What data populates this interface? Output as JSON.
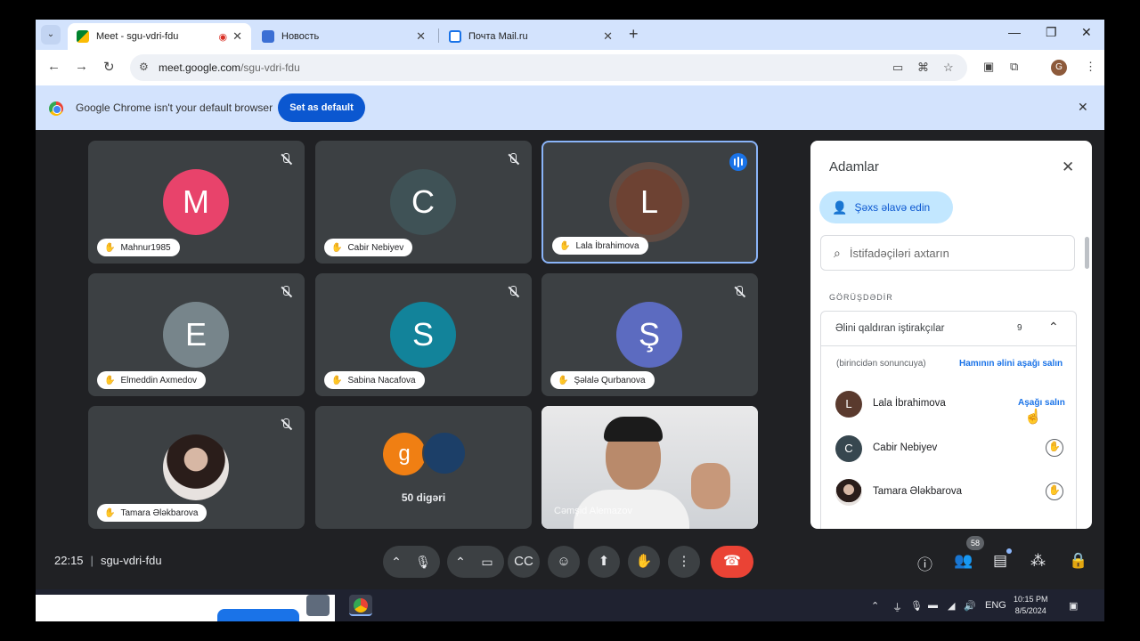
{
  "browser": {
    "tabs": [
      {
        "title": "Meet - sgu-vdri-fdu",
        "active": true
      },
      {
        "title": "Новость",
        "active": false
      },
      {
        "title": "Почта Mail.ru",
        "active": false
      }
    ],
    "url_host": "meet.google.com",
    "url_path": "/sgu-vdri-fdu",
    "profile_initial": "G"
  },
  "infobar": {
    "message": "Google Chrome isn't your default browser",
    "button": "Set as default"
  },
  "tiles": [
    {
      "name": "Mahnur1985",
      "initial": "M",
      "color": "#e8436b"
    },
    {
      "name": "Cabir Nebiyev",
      "initial": "C",
      "color": "#3f5256"
    },
    {
      "name": "Lala İbrahimova",
      "initial": "L",
      "color": "#6d4233"
    },
    {
      "name": "Elmeddin Axmedov",
      "initial": "E",
      "color": "#77858b"
    },
    {
      "name": "Sabina Nacafova",
      "initial": "S",
      "color": "#12839a"
    },
    {
      "name": "Şəlalə Qurbanova",
      "initial": "Ş",
      "color": "#5c6bc0"
    },
    {
      "name": "Tamara Ələkbarova",
      "initial": "",
      "color": "#d9c8c4"
    }
  ],
  "others": {
    "initial": "g",
    "label": "50 digəri"
  },
  "presenter": {
    "name": "Cəmşid Alemazov"
  },
  "people_panel": {
    "title": "Adamlar",
    "add_button": "Şəxs əlavə edin",
    "search_placeholder": "İstifadəçiləri axtarın",
    "section_header": "GÖRÜŞDƏDİR",
    "group_label": "Əlini qaldıran iştirakçılar",
    "group_count": "9",
    "order_hint": "(birincidən sonuncuya)",
    "lower_all": "Hamının əlini aşağı salın",
    "participants": [
      {
        "name": "Lala İbrahimova",
        "initial": "L",
        "color": "#5a3a2e",
        "action": "Aşağı salın"
      },
      {
        "name": "Cabir Nebiyev",
        "initial": "C",
        "color": "#37474f",
        "action": ""
      },
      {
        "name": "Tamara Ələkbarova",
        "initial": "",
        "color": "#c9b6b3",
        "action": ""
      }
    ]
  },
  "controls": {
    "time": "22:15",
    "meeting_code": "sgu-vdri-fdu",
    "participant_count": "58"
  },
  "taskbar": {
    "language": "ENG",
    "time": "10:15 PM",
    "date": "8/5/2024"
  }
}
